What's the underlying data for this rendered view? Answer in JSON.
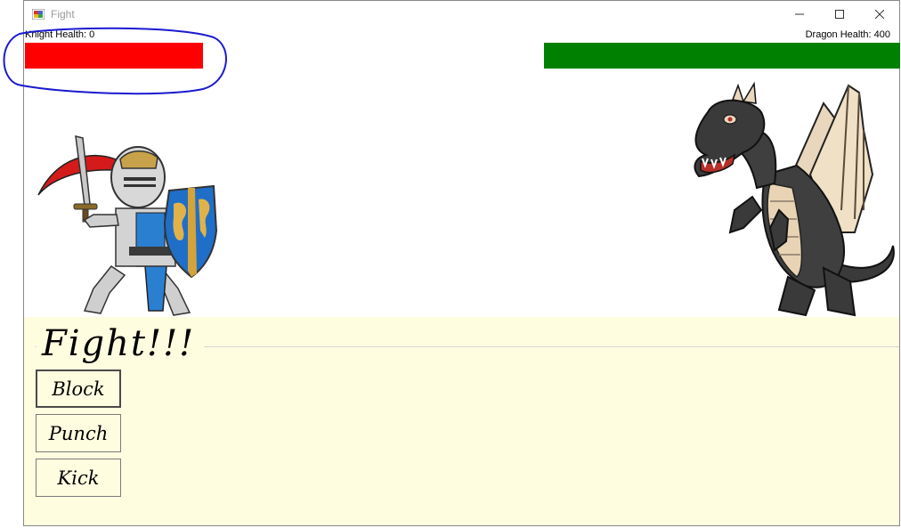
{
  "window": {
    "title": "Fight"
  },
  "controls": {
    "minimize": "—",
    "maximize": "☐",
    "close": "✕"
  },
  "knight": {
    "health_label": "Knight Health: 0",
    "health": 0,
    "bar_color": "#ff0000"
  },
  "dragon": {
    "health_label": "Dragon Health: 400",
    "health": 400,
    "bar_color": "#008000"
  },
  "panel": {
    "title": "Fight!!!",
    "background": "#fffddf"
  },
  "actions": {
    "block": "Block",
    "punch": "Punch",
    "kick": "Kick"
  },
  "sprites": {
    "knight_icon": "knight-with-sword-and-shield",
    "dragon_icon": "black-winged-dragon"
  },
  "annotation": {
    "color": "#1a1ad0"
  }
}
